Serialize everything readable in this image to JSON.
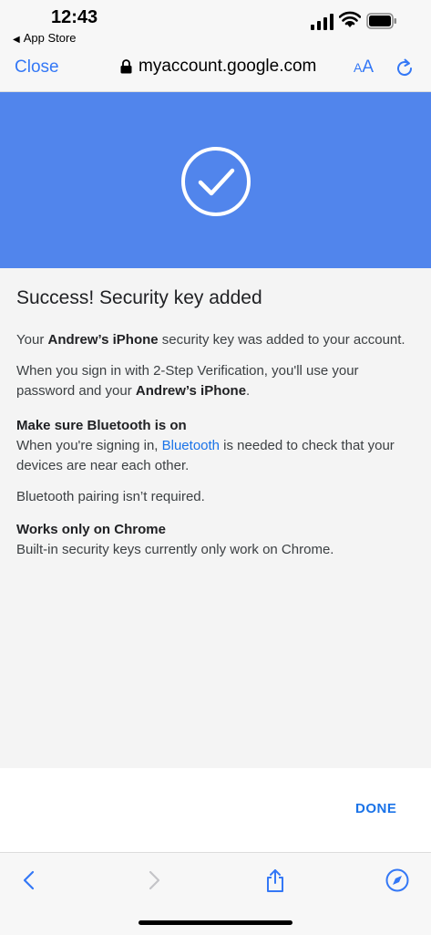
{
  "status_bar": {
    "time": "12:43",
    "back_app": "App Store"
  },
  "browser": {
    "close_label": "Close",
    "url": "myaccount.google.com",
    "text_size_small": "A",
    "text_size_large": "A"
  },
  "colors": {
    "hero_blue": "#5185ec",
    "ios_blue": "#3478f6",
    "google_blue": "#1a73e8"
  },
  "content": {
    "title": "Success! Security key added",
    "para1_pre": "Your ",
    "para1_device": "Andrew’s iPhone",
    "para1_post": " security key was added to your account.",
    "para2_pre": "When you sign in with 2-Step Verification, you'll use your password and your ",
    "para2_device": "Andrew’s iPhone",
    "para2_post": ".",
    "bluetooth_heading": "Make sure Bluetooth is on",
    "bluetooth_pre": "When you're signing in, ",
    "bluetooth_link": "Bluetooth",
    "bluetooth_post": " is needed to check that your devices are near each other.",
    "pairing_note": "Bluetooth pairing isn’t required.",
    "chrome_heading": "Works only on Chrome",
    "chrome_text": "Built-in security keys currently only work on Chrome."
  },
  "footer": {
    "done_label": "DONE"
  },
  "icons": {
    "lock": "lock-icon",
    "reload": "reload-icon",
    "check": "check-circle-icon",
    "back": "chevron-left-icon",
    "forward": "chevron-right-icon",
    "share": "share-icon",
    "safari": "compass-icon"
  }
}
